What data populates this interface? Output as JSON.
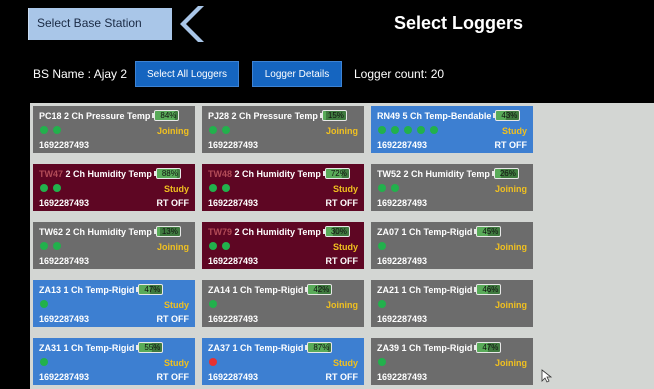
{
  "header": {
    "select_base_station": "Select Base Station",
    "title": "Select Loggers"
  },
  "toolbar": {
    "bs_name": "BS Name :  Ajay 2",
    "select_all": "Select All Loggers",
    "logger_details": "Logger Details",
    "logger_count": "Logger count: 20"
  },
  "colors": {
    "gray_card": "#6c6c6c",
    "maroon_card": "#5e0623",
    "blue_card": "#3d7fd1",
    "status_yellow": "#f0c020",
    "dot_green": "#22b14c",
    "dot_red": "#e63232"
  },
  "loggers": [
    {
      "id": "PC18",
      "type": "2 Ch Pressure Temp",
      "battery": "84%",
      "level": 0.84,
      "status": "Joining",
      "serial": "1692287493",
      "rt": "",
      "color": "gray",
      "dots": [
        "green",
        "green"
      ]
    },
    {
      "id": "PJ28",
      "type": "2 Ch Pressure Temp",
      "battery": "15%",
      "level": 0.15,
      "status": "Joining",
      "serial": "1692287493",
      "rt": "",
      "color": "gray",
      "dots": [
        "green",
        "green"
      ]
    },
    {
      "id": "RN49",
      "type": "5 Ch Temp-Bendable",
      "battery": "43%",
      "level": 0.43,
      "status": "Study",
      "serial": "1692287493",
      "rt": "RT OFF",
      "color": "blue",
      "dots": [
        "green",
        "green",
        "green",
        "green",
        "green"
      ]
    },
    {
      "id": "TW47",
      "type": "2 Ch Humidity Temp",
      "battery": "88%",
      "level": 0.88,
      "status": "Study",
      "serial": "1692287493",
      "rt": "RT OFF",
      "color": "maroon",
      "dots": [
        "green",
        "green"
      ]
    },
    {
      "id": "TW48",
      "type": "2 Ch Humidity Temp",
      "battery": "72%",
      "level": 0.72,
      "status": "Study",
      "serial": "1692287493",
      "rt": "RT OFF",
      "color": "maroon",
      "dots": [
        "green",
        "green"
      ]
    },
    {
      "id": "TW52",
      "type": "2 Ch Humidity Temp",
      "battery": "26%",
      "level": 0.26,
      "status": "Joining",
      "serial": "1692287493",
      "rt": "",
      "color": "gray",
      "dots": [
        "green",
        "green"
      ]
    },
    {
      "id": "TW62",
      "type": "2 Ch Humidity Temp",
      "battery": "13%",
      "level": 0.13,
      "status": "Joining",
      "serial": "1692287493",
      "rt": "",
      "color": "gray",
      "dots": [
        "green",
        "green"
      ]
    },
    {
      "id": "TW79",
      "type": "2 Ch Humidity Temp",
      "battery": "30%",
      "level": 0.3,
      "status": "Study",
      "serial": "1692287493",
      "rt": "RT OFF",
      "color": "maroon",
      "dots": [
        "green",
        "green"
      ]
    },
    {
      "id": "ZA07",
      "type": "1 Ch Temp-Rigid",
      "battery": "45%",
      "level": 0.45,
      "status": "Joining",
      "serial": "1692287493",
      "rt": "",
      "color": "gray",
      "dots": [
        "green"
      ]
    },
    {
      "id": "ZA13",
      "type": "1 Ch Temp-Rigid",
      "battery": "47%",
      "level": 0.47,
      "status": "Study",
      "serial": "1692287493",
      "rt": "RT OFF",
      "color": "blue",
      "dots": [
        "green"
      ]
    },
    {
      "id": "ZA14",
      "type": "1 Ch Temp-Rigid",
      "battery": "42%",
      "level": 0.42,
      "status": "Joining",
      "serial": "1692287493",
      "rt": "",
      "color": "gray",
      "dots": [
        "green"
      ]
    },
    {
      "id": "ZA21",
      "type": "1 Ch Temp-Rigid",
      "battery": "46%",
      "level": 0.46,
      "status": "Joining",
      "serial": "1692287493",
      "rt": "",
      "color": "gray",
      "dots": [
        "green"
      ]
    },
    {
      "id": "ZA31",
      "type": "1 Ch Temp-Rigid",
      "battery": "55%",
      "level": 0.55,
      "status": "Study",
      "serial": "1692287493",
      "rt": "RT OFF",
      "color": "blue",
      "dots": [
        "green"
      ]
    },
    {
      "id": "ZA37",
      "type": "1 Ch Temp-Rigid",
      "battery": "87%",
      "level": 0.87,
      "status": "Study",
      "serial": "1692287493",
      "rt": "RT OFF",
      "color": "blue",
      "dots": [
        "red"
      ]
    },
    {
      "id": "ZA39",
      "type": "1 Ch Temp-Rigid",
      "battery": "47%",
      "level": 0.47,
      "status": "Joining",
      "serial": "1692287493",
      "rt": "",
      "color": "gray",
      "dots": [
        "green"
      ]
    }
  ]
}
